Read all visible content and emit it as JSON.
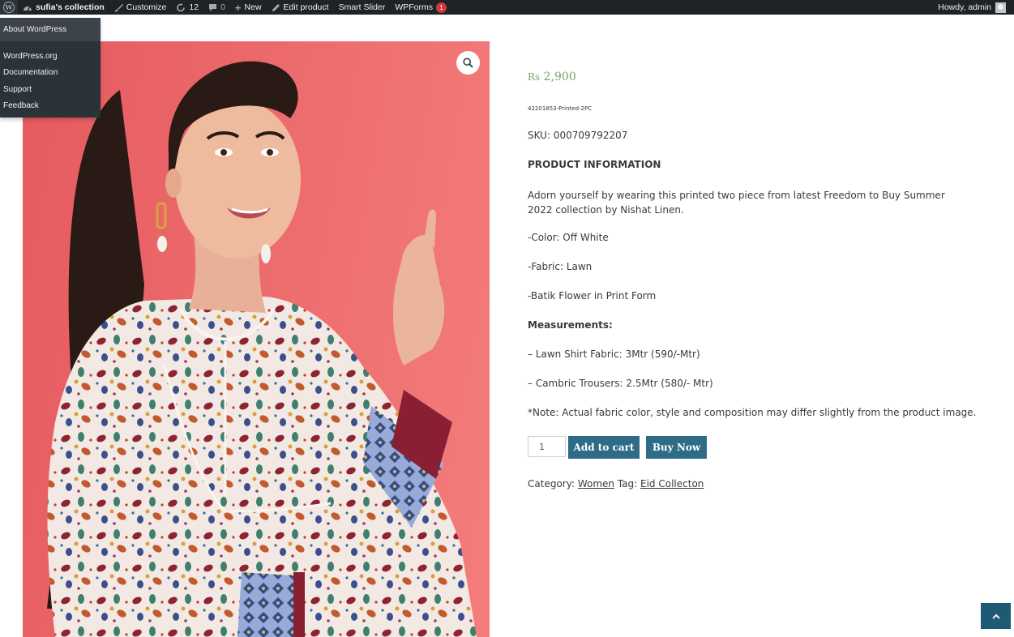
{
  "adminbar": {
    "site_name": "sufia's collection",
    "customize": "Customize",
    "updates_count": "12",
    "comments_count": "0",
    "new_label": "New",
    "edit_product": "Edit product",
    "smart_slider": "Smart Slider",
    "wpforms": "WPForms",
    "wpforms_badge": "1",
    "howdy": "Howdy, admin"
  },
  "wp_menu": {
    "about": "About WordPress",
    "items": [
      "WordPress.org",
      "Documentation",
      "Support",
      "Feedback"
    ]
  },
  "product": {
    "currency": "Rs",
    "price": "2,900",
    "short_code": "42201853-Printed-2PC",
    "sku": "SKU: 000709792207",
    "info_heading": "PRODUCT INFORMATION",
    "description": "Adorn yourself by wearing this printed two piece from latest Freedom to Buy Summer 2022 collection by Nishat Linen.",
    "color": "-Color: Off White",
    "fabric": "-Fabric: Lawn",
    "batik": "-Batik Flower in Print Form",
    "measurements_heading": "Measurements:",
    "shirt": "– Lawn Shirt Fabric: 3Mtr (590/-Mtr)",
    "trousers": "– Cambric Trousers: 2.5Mtr (580/- Mtr)",
    "note": "*Note: Actual fabric color, style and composition may differ slightly from the product image.",
    "quantity": "1",
    "add_to_cart": "Add to cart",
    "buy_now": "Buy Now",
    "category_label": "Category:",
    "category": "Women",
    "tag_label": "Tag:",
    "tag": "Eid Collecton"
  },
  "icons": {
    "zoom": "magnifier-icon",
    "scroll_top": "chevron-up-icon"
  },
  "colors": {
    "adminbar_bg": "#1d2327",
    "price": "#77a464",
    "button": "#2e6b86",
    "badge": "#d63638"
  }
}
